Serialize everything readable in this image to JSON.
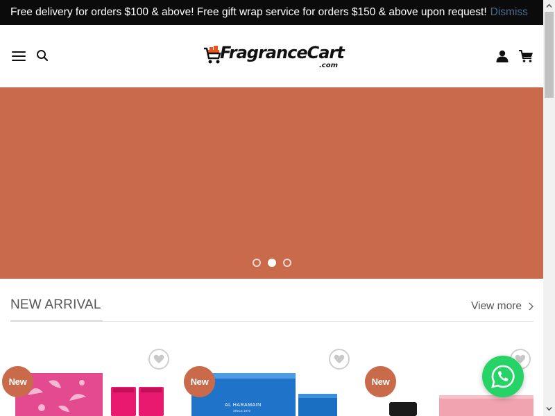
{
  "announcement": {
    "text": "Free delivery for orders $100 & above! Free gift wrap service for orders $150 & above upon request!",
    "dismiss_label": "Dismiss"
  },
  "header": {
    "logo_text": "FragranceCart",
    "logo_suffix": ".com",
    "icons": [
      "menu-icon",
      "search-icon",
      "user-icon",
      "cart-icon"
    ]
  },
  "hero": {
    "background_color": "#c96b4b",
    "slide_count": 3,
    "active_slide": 2
  },
  "section": {
    "title": "NEW ARRIVAL",
    "view_more_label": "View more"
  },
  "products": [
    {
      "badge": "New",
      "wishlist_icon": "heart-icon"
    },
    {
      "badge": "New",
      "wishlist_icon": "heart-icon",
      "box_text": "AL HARAMAIN",
      "box_subtext": "SINCE 1970"
    },
    {
      "badge": "New",
      "wishlist_icon": "heart-icon"
    }
  ],
  "colors": {
    "accent": "#c96b4b",
    "topbar": "#0b0b0b",
    "whatsapp": "#25d366"
  }
}
